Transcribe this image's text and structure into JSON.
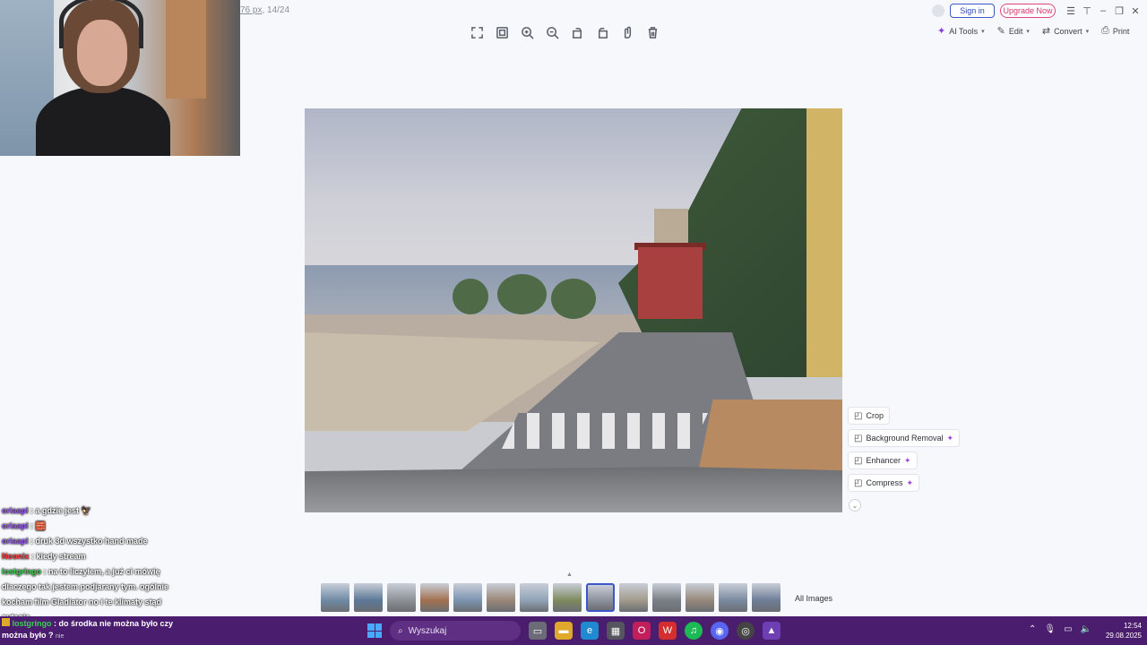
{
  "file_info": {
    "size": "76 px",
    "index": "14/24"
  },
  "toolbar": {
    "buttons": [
      "fullscreen-icon",
      "fit-icon",
      "zoom-in-icon",
      "zoom-out-icon",
      "rotate-left-icon",
      "rotate-right-icon",
      "hand-icon",
      "delete-icon"
    ]
  },
  "header": {
    "sign_in": "Sign in",
    "upgrade": "Upgrade Now",
    "ai_tools": "AI Tools",
    "edit": "Edit",
    "convert": "Convert",
    "print": "Print"
  },
  "side_tools": [
    {
      "label": "Crop",
      "icon": "crop-icon",
      "premium": false
    },
    {
      "label": "Background Removal",
      "icon": "background-removal-icon",
      "premium": true
    },
    {
      "label": "Enhancer",
      "icon": "enhancer-icon",
      "premium": true
    },
    {
      "label": "Compress",
      "icon": "compress-icon",
      "premium": true
    }
  ],
  "gallery": {
    "all_images": "All Images",
    "active_index": 8,
    "thumb_colors": [
      "#6f8aa5",
      "#5b7896",
      "#8c8f94",
      "#a3704f",
      "#7c93b0",
      "#9a8778",
      "#8fa3b6",
      "#7e8a5e",
      "#8d939c",
      "#a29a8c",
      "#7a7f86",
      "#96887a",
      "#7b8aa0",
      "#6e7e97"
    ]
  },
  "chat": [
    {
      "user": "oriaapl",
      "text": ": a gdzie jest",
      "emote": "🦅",
      "color": "u1"
    },
    {
      "user": "oriaapl",
      "text": ":",
      "emote": "🧱",
      "color": "u1"
    },
    {
      "user": "oriaapl",
      "text": ": druk 3d wszystko hand made",
      "emote": "",
      "color": "u1"
    },
    {
      "user": "Noonix",
      "text": ": kiedy stream",
      "emote": "",
      "color": "u2"
    },
    {
      "user": "lostgringo",
      "text": ": na to liczyłem, a już ci mówię dlaczego tak jestem podjarany tym. ogólnie kocham film Gladiator no i te klimaty stąd pytanie",
      "emote": "",
      "color": "u3"
    }
  ],
  "chat_bottom": {
    "user": "lostgringo",
    "text": ": do środka nie można było czy można było ?",
    "suffix": "nie"
  },
  "taskbar": {
    "search_placeholder": "Wyszukaj",
    "time": "12:54",
    "date": "29.08.2025"
  }
}
